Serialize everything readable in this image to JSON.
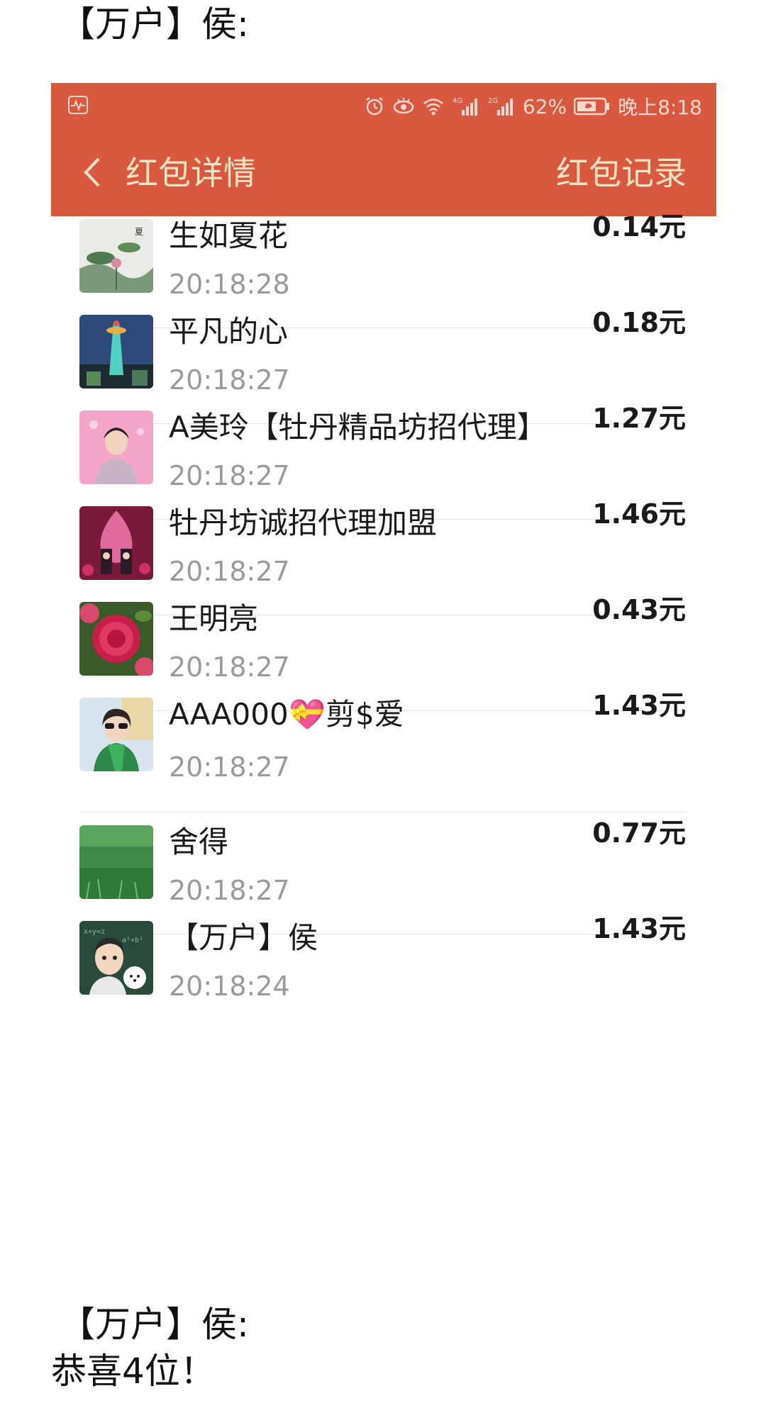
{
  "chat": {
    "top_sender": "【万户】侯:",
    "bottom_sender": "【万户】侯:",
    "message": "恭喜4位！"
  },
  "status_bar": {
    "signal_1_label": "4G",
    "signal_2_label": "2G",
    "battery": "62%",
    "time": "晚上8:18"
  },
  "nav": {
    "title": "红包详情",
    "action": "红包记录"
  },
  "records": [
    {
      "name": "生如夏花",
      "time": "20:18:28",
      "amount": "0.14元",
      "avatar_icon": "lotus-painting-avatar"
    },
    {
      "name": "平凡的心",
      "time": "20:18:27",
      "amount": "0.18元",
      "avatar_icon": "tower-avatar"
    },
    {
      "name": "A美玲【牡丹精品坊招代理】",
      "time": "20:18:27",
      "amount": "1.27元",
      "avatar_icon": "woman-pink-avatar"
    },
    {
      "name": "牡丹坊诚招代理加盟",
      "time": "20:18:27",
      "amount": "1.46元",
      "avatar_icon": "product-poster-avatar"
    },
    {
      "name": "王明亮",
      "time": "20:18:27",
      "amount": "0.43元",
      "avatar_icon": "peony-flower-avatar"
    },
    {
      "name": "AAA000💝剪$爱",
      "time": "20:18:27",
      "amount": "1.43元",
      "avatar_icon": "woman-scarf-avatar"
    },
    {
      "name": "舍得",
      "time": "20:18:27",
      "amount": "0.77元",
      "avatar_icon": "grass-avatar"
    },
    {
      "name": "【万户】侯",
      "time": "20:18:24",
      "amount": "1.43元",
      "avatar_icon": "cartoon-man-dog-avatar"
    }
  ],
  "colors": {
    "header_bg": "#d95940",
    "header_text": "#f8e2c2",
    "time_text": "#9a9a9a"
  }
}
